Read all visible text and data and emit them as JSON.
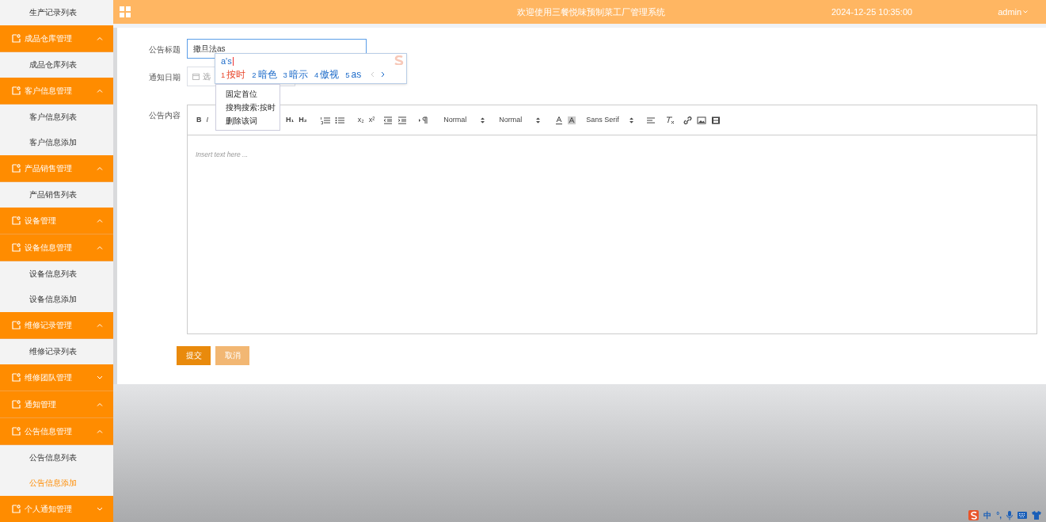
{
  "sidebar": {
    "items": [
      {
        "kind": "continuation",
        "children": [
          {
            "kind": "link",
            "label": "生产记录列表",
            "selected": false
          },
          {
            "kind": "group",
            "label": "成品仓库管理",
            "expanded": true,
            "children": [
              {
                "kind": "link",
                "label": "成品仓库列表",
                "selected": false
              }
            ]
          },
          {
            "kind": "group",
            "label": "客户信息管理",
            "expanded": true,
            "children": [
              {
                "kind": "link",
                "label": "客户信息列表",
                "selected": false
              },
              {
                "kind": "link",
                "label": "客户信息添加",
                "selected": false
              }
            ]
          },
          {
            "kind": "group",
            "label": "产品销售管理",
            "expanded": true,
            "children": [
              {
                "kind": "link",
                "label": "产品销售列表",
                "selected": false
              }
            ]
          }
        ]
      },
      {
        "kind": "group",
        "label": "设备管理",
        "expanded": true,
        "children": [
          {
            "kind": "group",
            "label": "设备信息管理",
            "expanded": true,
            "children": [
              {
                "kind": "link",
                "label": "设备信息列表",
                "selected": false
              },
              {
                "kind": "link",
                "label": "设备信息添加",
                "selected": false
              }
            ]
          },
          {
            "kind": "group",
            "label": "维修记录管理",
            "expanded": true,
            "children": [
              {
                "kind": "link",
                "label": "维修记录列表",
                "selected": false
              }
            ]
          },
          {
            "kind": "group",
            "label": "维修团队管理",
            "expanded": false
          }
        ]
      },
      {
        "kind": "group",
        "label": "通知管理",
        "expanded": true,
        "children": [
          {
            "kind": "group",
            "label": "公告信息管理",
            "expanded": true,
            "children": [
              {
                "kind": "link",
                "label": "公告信息列表",
                "selected": false
              },
              {
                "kind": "link",
                "label": "公告信息添加",
                "selected": true
              }
            ]
          },
          {
            "kind": "group",
            "label": "个人通知管理",
            "expanded": false
          }
        ]
      }
    ]
  },
  "header": {
    "title": "欢迎使用三餐悦味预制菜工厂管理系统",
    "datetime": "2024-12-25 10:35:00",
    "user": "admin"
  },
  "form": {
    "fields": [
      {
        "label": "公告标题",
        "kind": "text",
        "value": "撒旦法as"
      },
      {
        "label": "通知日期",
        "kind": "date",
        "placeholder": "选"
      },
      {
        "label": "公告内容",
        "kind": "editor",
        "placeholder": "Insert text here ..."
      }
    ],
    "toolbar": {
      "bold": "B",
      "italic": "I",
      "h1": "H₁",
      "h2": "H₂",
      "subscript": "x₂",
      "superscript": "x²",
      "size": "Normal",
      "header": "Normal",
      "font": "Sans Serif"
    },
    "buttons": [
      {
        "label": "提交",
        "kind": "primary"
      },
      {
        "label": "取消",
        "kind": "secondary"
      }
    ]
  },
  "ime": {
    "composition": "a's",
    "candidates": [
      {
        "number": "1",
        "text": "按时",
        "selected": true
      },
      {
        "number": "2",
        "text": "暗色",
        "selected": false
      },
      {
        "number": "3",
        "text": "暗示",
        "selected": false
      },
      {
        "number": "4",
        "text": "傲视",
        "selected": false
      },
      {
        "number": "5",
        "text": "as",
        "selected": false
      }
    ],
    "menu": [
      "固定首位",
      "搜狗搜索:按时",
      "删除该词"
    ]
  },
  "tray": {
    "mode": "中",
    "punctuation": "°,"
  }
}
